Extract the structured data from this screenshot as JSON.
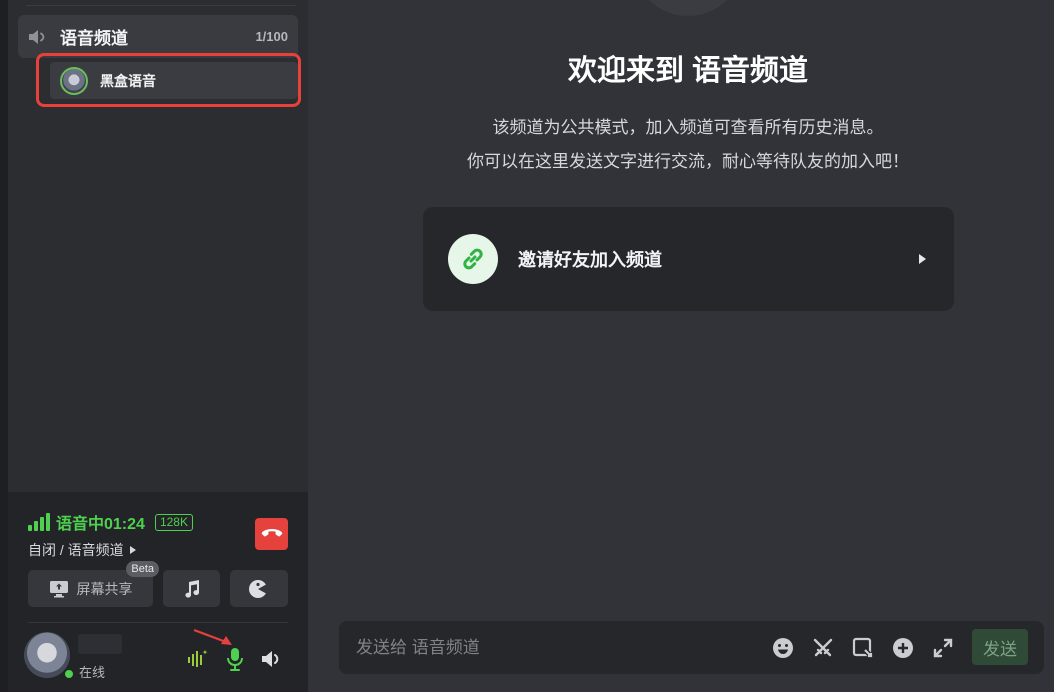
{
  "sidebar": {
    "channel": {
      "name": "语音频道",
      "count": "1/100",
      "icon": "speaker-icon"
    },
    "members": [
      {
        "name": "黑盒语音",
        "icon": "avatar"
      }
    ]
  },
  "voice_panel": {
    "status_title": "语音中01:24",
    "bitrate_badge": "128K",
    "path": "自闭 / 语音频道",
    "screen_share_label": "屏幕共享",
    "beta_badge": "Beta",
    "user_status": "在线"
  },
  "main": {
    "welcome_title": "欢迎来到 语音频道",
    "welcome_line1": "该频道为公共模式，加入频道可查看所有历史消息。",
    "welcome_line2": "你可以在这里发送文字进行交流，耐心等待队友的加入吧！",
    "invite_label": "邀请好友加入频道",
    "composer_placeholder": "发送给 语音频道",
    "send_label": "发送"
  },
  "colors": {
    "accent_green": "#4fd04f",
    "hangup_red": "#e5413d",
    "highlight_red": "#e8413b",
    "sidebar_bg": "#2b2d31",
    "main_bg": "#313338"
  }
}
